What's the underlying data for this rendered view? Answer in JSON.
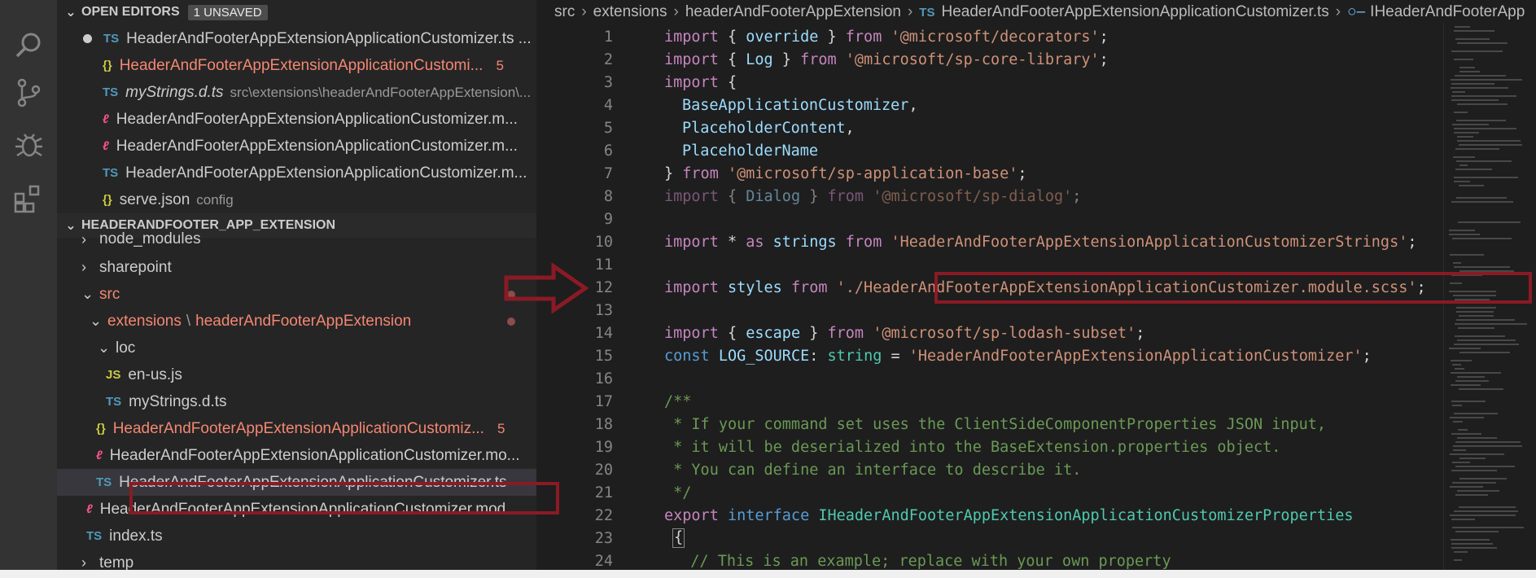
{
  "open_editors": {
    "title": "OPEN EDITORS",
    "badge": "1 UNSAVED",
    "items": [
      {
        "icon": "TS",
        "name": "HeaderAndFooterAppExtensionApplicationCustomizer.ts ...",
        "detail": "",
        "modified": true
      },
      {
        "icon": "{}",
        "name": "HeaderAndFooterAppExtensionApplicationCustomi...",
        "detail": "",
        "errors": "5"
      },
      {
        "icon": "TS",
        "name": "myStrings.d.ts",
        "detail": "src\\extensions\\headerAndFooterAppExtension\\..."
      },
      {
        "icon": "mod",
        "name": "HeaderAndFooterAppExtensionApplicationCustomizer.m..."
      },
      {
        "icon": "mod",
        "name": "HeaderAndFooterAppExtensionApplicationCustomizer.m..."
      },
      {
        "icon": "TS",
        "name": "HeaderAndFooterAppExtensionApplicationCustomizer.m..."
      },
      {
        "icon": "{}",
        "name": "serve.json",
        "detail": "config"
      }
    ]
  },
  "explorer": {
    "title": "HEADERANDFOOTER_APP_EXTENSION",
    "items": [
      {
        "name": "node_modules"
      },
      {
        "name": "sharepoint"
      },
      {
        "name": "src"
      },
      {
        "name": "extensions",
        "path_sep": "\\",
        "subname": "headerAndFooterAppExtension"
      },
      {
        "name": "loc"
      },
      {
        "icon": "JS",
        "name": "en-us.js"
      },
      {
        "icon": "TS",
        "name": "myStrings.d.ts"
      },
      {
        "icon": "{}",
        "name": "HeaderAndFooterAppExtensionApplicationCustomiz...",
        "errors": "5"
      },
      {
        "icon": "mod",
        "name": "HeaderAndFooterAppExtensionApplicationCustomizer.mo..."
      },
      {
        "icon": "TS",
        "name": "HeaderAndFooterAppExtensionApplicationCustomizer.ts"
      },
      {
        "icon": "mod",
        "name": "HeaderAndFooterAppExtensionApplicationCustomizer.mod..."
      },
      {
        "icon": "TS",
        "name": "index.ts"
      },
      {
        "name": "temp"
      }
    ]
  },
  "breadcrumb": {
    "parts": [
      "src",
      "extensions",
      "headerAndFooterAppExtension"
    ],
    "file_icon": "TS",
    "file": "HeaderAndFooterAppExtensionApplicationCustomizer.ts",
    "symbol": "IHeaderAndFooterApp"
  },
  "code": {
    "line_numbers": [
      "1",
      "2",
      "3",
      "4",
      "5",
      "6",
      "7",
      "8",
      "9",
      "10",
      "11",
      "12",
      "13",
      "14",
      "15",
      "16",
      "17",
      "18",
      "19",
      "20",
      "21",
      "22",
      "23",
      "24"
    ],
    "l1": {
      "a": "import",
      "b": " { ",
      "c": "override",
      "d": " } ",
      "e": "from",
      "f": " ",
      "g": "'@microsoft/decorators'",
      "h": ";"
    },
    "l2": {
      "a": "import",
      "b": " { ",
      "c": "Log",
      "d": " } ",
      "e": "from",
      "f": " ",
      "g": "'@microsoft/sp-core-library'",
      "h": ";"
    },
    "l3": {
      "a": "import",
      "b": " {"
    },
    "l4": {
      "c": "BaseApplicationCustomizer",
      "d": ","
    },
    "l5": {
      "c": "PlaceholderContent",
      "d": ","
    },
    "l6": {
      "c": "PlaceholderName"
    },
    "l7": {
      "b": "} ",
      "e": "from",
      "f": " ",
      "g": "'@microsoft/sp-application-base'",
      "h": ";"
    },
    "l8": {
      "a": "import",
      "b": " { ",
      "c": "Dialog",
      "d": " } ",
      "e": "from",
      "f": " ",
      "g": "'@microsoft/sp-dialog'",
      "h": ";"
    },
    "l10": {
      "a": "import",
      "b": " * ",
      "e": "as",
      "c": "strings",
      "e2": "from",
      "g": "'HeaderAndFooterAppExtensionApplicationCustomizerStrings'",
      "h": ";"
    },
    "l12": {
      "a": "import",
      "c": "styles",
      "e": "from",
      "g": "'./HeaderAndFooterAppExtensionApplicationCustomizer.module.scss'",
      "h": ";"
    },
    "l14": {
      "a": "import",
      "b": " { ",
      "c": "escape",
      "d": " } ",
      "e": "from",
      "g": "'@microsoft/sp-lodash-subset'",
      "h": ";"
    },
    "l15": {
      "a": "const",
      "c": "LOG_SOURCE",
      "d": ": ",
      "t": "string",
      "eq": " = ",
      "g": "'HeaderAndFooterAppExtensionApplicationCustomizer'",
      "h": ";"
    },
    "l17": "/**",
    "l18": " * If your command set uses the ClientSideComponentProperties JSON input,",
    "l19": " * it will be deserialized into the BaseExtension.properties object.",
    "l20": " * You can define an interface to describe it.",
    "l21": " */",
    "l22": {
      "a": "export",
      "b": "interface",
      "t": "IHeaderAndFooterAppExtensionApplicationCustomizerProperties"
    },
    "l23": "{",
    "l24": "  // This is an example; replace with your own property"
  },
  "colors": {
    "keyword": "#c586c0",
    "string": "#ce9178",
    "identifier": "#9cdcfe",
    "type": "#4ec9b0",
    "comment": "#6a9955",
    "highlight_box": "#8b1a24"
  },
  "icons": [
    "search-icon",
    "source-control-icon",
    "debug-icon",
    "extensions-icon"
  ]
}
